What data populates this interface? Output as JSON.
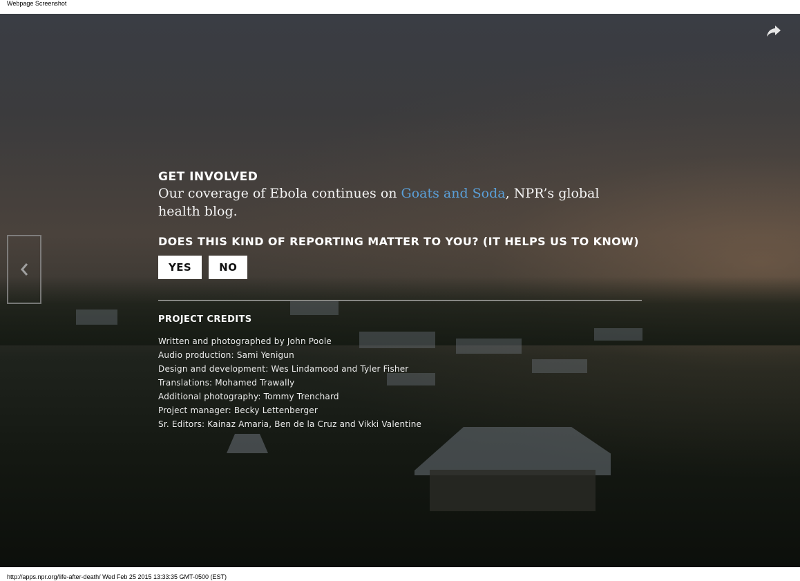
{
  "window": {
    "top_caption": "Webpage Screenshot",
    "bottom_caption": "http://apps.npr.org/life-after-death/ Wed Feb 25 2015 13:33:35 GMT-0500 (EST)"
  },
  "icons": {
    "share": "share-arrow-icon",
    "prev": "chevron-left-icon"
  },
  "colors": {
    "link": "#5a9fd8",
    "button_bg": "#ffffff",
    "text": "#ffffff"
  },
  "involved": {
    "heading": "GET INVOLVED",
    "text_before": "Our coverage of Ebola continues on ",
    "link_text": "Goats and Soda",
    "text_after": ", NPR’s global health blog."
  },
  "survey": {
    "question": "DOES THIS KIND OF REPORTING MATTER TO YOU? (IT HELPS US TO KNOW)",
    "yes_label": "YES",
    "no_label": "NO"
  },
  "credits": {
    "heading": "PROJECT CREDITS",
    "items": [
      "Written and photographed by John Poole",
      "Audio production: Sami Yenigun",
      "Design and development: Wes Lindamood and Tyler Fisher",
      "Translations: Mohamed Trawally",
      "Additional photography: Tommy Trenchard",
      "Project manager: Becky Lettenberger",
      "Sr. Editors: Kainaz Amaria, Ben de la Cruz and Vikki Valentine"
    ]
  }
}
